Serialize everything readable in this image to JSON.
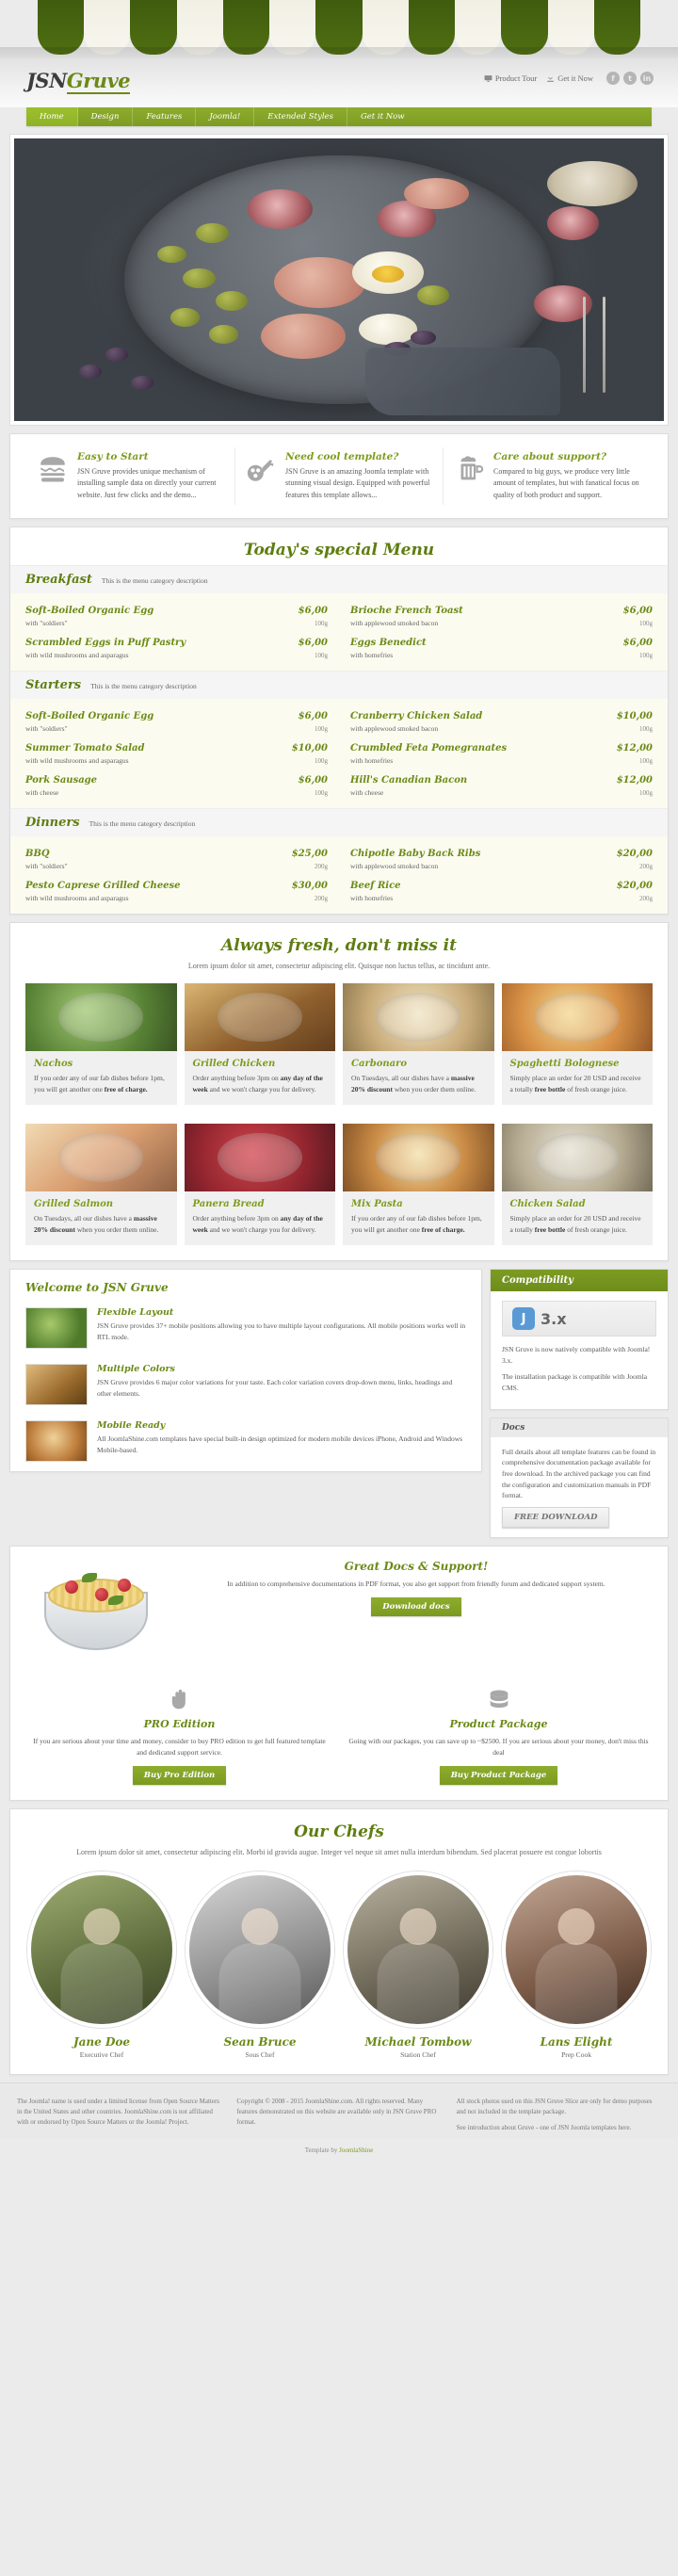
{
  "brand": {
    "logo_jsn": "JSN",
    "logo_gruve": "Gruve"
  },
  "topbar": {
    "product_tour": "Product Tour",
    "get_it_now": "Get it Now",
    "social": [
      "f",
      "t",
      "in"
    ]
  },
  "nav": [
    {
      "label": "Home",
      "active": true
    },
    {
      "label": "Design",
      "active": false
    },
    {
      "label": "Features",
      "active": false
    },
    {
      "label": "Joomla!",
      "active": false
    },
    {
      "label": "Extended Styles",
      "active": false
    },
    {
      "label": "Get it Now",
      "active": false
    }
  ],
  "features": [
    {
      "icon": "burger-icon",
      "title": "Easy to Start",
      "text": "JSN Gruve provides unique mechanism of installing sample data on directly your current website. Just few clicks and the demo..."
    },
    {
      "icon": "chicken-leg-icon",
      "title": "Need cool template?",
      "text": "JSN Gruve is an amazing Joomla template with stunning visual design. Equipped with powerful features this template allows..."
    },
    {
      "icon": "beer-mug-icon",
      "title": "Care about support?",
      "text": "Compared to big guys, we produce very little amount of templates, but with fanatical focus on quality of both product and support."
    }
  ],
  "menu": {
    "title": "Today's special Menu",
    "categories": [
      {
        "name": "Breakfast",
        "description": "This is the menu category description",
        "items": [
          {
            "name": "Soft-Boiled Organic Egg",
            "price": "$6,00",
            "desc": "with \"soldiers\"",
            "weight": "100g"
          },
          {
            "name": "Brioche French Toast",
            "price": "$6,00",
            "desc": "with applewood smoked bacon",
            "weight": "100g"
          },
          {
            "name": "Scrambled Eggs in Puff Pastry",
            "price": "$6,00",
            "desc": "with wild mushrooms and asparagus",
            "weight": "100g"
          },
          {
            "name": "Eggs Benedict",
            "price": "$6,00",
            "desc": "with homefries",
            "weight": "100g"
          }
        ]
      },
      {
        "name": "Starters",
        "description": "This is the menu category description",
        "items": [
          {
            "name": "Soft-Boiled Organic Egg",
            "price": "$6,00",
            "desc": "with \"soldiers\"",
            "weight": "100g"
          },
          {
            "name": "Cranberry Chicken Salad",
            "price": "$10,00",
            "desc": "with applewood smoked bacon",
            "weight": "100g"
          },
          {
            "name": "Summer Tomato Salad",
            "price": "$10,00",
            "desc": "with wild mushrooms and asparagus",
            "weight": "100g"
          },
          {
            "name": "Crumbled Feta Pomegranates",
            "price": "$12,00",
            "desc": "with homefries",
            "weight": "100g"
          },
          {
            "name": "Pork Sausage",
            "price": "$6,00",
            "desc": "with cheese",
            "weight": "100g"
          },
          {
            "name": "Hill's Canadian Bacon",
            "price": "$12,00",
            "desc": "with cheese",
            "weight": "100g"
          }
        ]
      },
      {
        "name": "Dinners",
        "description": "This is the menu category description",
        "items": [
          {
            "name": "BBQ",
            "price": "$25,00",
            "desc": "with \"soldiers\"",
            "weight": "200g"
          },
          {
            "name": "Chipotle Baby Back Ribs",
            "price": "$20,00",
            "desc": "with applewood smoked bacon",
            "weight": "200g"
          },
          {
            "name": "Pesto Caprese Grilled Cheese",
            "price": "$30,00",
            "desc": "with wild mushrooms and asparagus",
            "weight": "200g"
          },
          {
            "name": "Beef Rice",
            "price": "$20,00",
            "desc": "with homefries",
            "weight": "200g"
          }
        ]
      }
    ]
  },
  "fresh": {
    "title": "Always fresh, don't miss it",
    "subtitle": "Lorem ipsum dolor sit amet, consectetur adipiscing elit. Quisque non luctus tellus, ac tincidunt ante.",
    "cards": [
      {
        "art": "ci-salad",
        "title": "Nachos",
        "text_1": "If you order any of our fab dishes before 1pm, you will get another one ",
        "bold": "free of charge.",
        "text_2": ""
      },
      {
        "art": "ci-chicken",
        "title": "Grilled Chicken",
        "text_1": "Order anything before 3pm on ",
        "bold": "any day of the week",
        "text_2": " and we won't charge you for delivery."
      },
      {
        "art": "ci-carbonara",
        "title": "Carbonaro",
        "text_1": "On Tuesdays, all our dishes have a ",
        "bold": "massive 20% discount",
        "text_2": " when you order them online."
      },
      {
        "art": "ci-bolognese",
        "title": "Spaghetti Bolognese",
        "text_1": "Simply place an order for 20 USD and receive a totally ",
        "bold": "free bottle",
        "text_2": " of fresh orange juice."
      },
      {
        "art": "ci-salmon",
        "title": "Grilled Salmon",
        "text_1": "On Tuesdays, all our dishes have a ",
        "bold": "massive 20% discount",
        "text_2": " when you order them online."
      },
      {
        "art": "ci-panera",
        "title": "Panera Bread",
        "text_1": "Order anything before 3pm on ",
        "bold": "any day of the week",
        "text_2": " and we won't charge you for delivery."
      },
      {
        "art": "ci-pasta",
        "title": "Mix Pasta",
        "text_1": "If you order any of our fab dishes before 1pm, you will get another one ",
        "bold": "free of charge.",
        "text_2": ""
      },
      {
        "art": "ci-chsalad",
        "title": "Chicken Salad",
        "text_1": "Simply place an order for 20 USD and receive a totally ",
        "bold": "free bottle",
        "text_2": " of fresh orange juice."
      }
    ]
  },
  "welcome": {
    "title": "Welcome to JSN Gruve",
    "rows": [
      {
        "art": "wi-sprouts",
        "title": "Flexible Layout",
        "text": "JSN Gruve provides 37+ mobile positions allowing you to have multiple layout configurations. All mobile positions works well in RTL mode."
      },
      {
        "art": "wi-bread",
        "title": "Multiple Colors",
        "text": "JSN Gruve provides 6 major color variations for your taste. Each color variation covers drop-down menu, links, headings and other elements."
      },
      {
        "art": "wi-bowl",
        "title": "Mobile Ready",
        "text": "All JoomlaShine.com templates have special built-in design optimized for modern mobile devices iPhone, Android and Windows Mobile-based."
      }
    ]
  },
  "sidebar": {
    "compat_title": "Compatibility",
    "joomla_label": "Joomla!",
    "joomla_version": "3.x",
    "compat_text_1": "JSN Gruve is now natively compatible with Joomla! 3.x.",
    "compat_text_2": "The installation package is compatible with Joomla CMS.",
    "docs_title": "Docs",
    "docs_text": "Full details about all template features can be found in comprehensive documentation package available for free download. In the archived package you can find the configuration and customization manuals in PDF format.",
    "docs_button": "FREE DOWNLOAD"
  },
  "support": {
    "title": "Great Docs & Support!",
    "text": "In addition to comprehensive documentations in PDF format, you also get support from friendly forum and dedicated support system.",
    "button": "Download docs",
    "promos": [
      {
        "icon": "hand-icon",
        "title": "PRO Edition",
        "text": "If you are serious about your time and money, consider to buy PRO edition to get full featured template and dedicated support service.",
        "button": "Buy Pro Edition"
      },
      {
        "icon": "money-icon",
        "title": "Product Package",
        "text": "Going with our packages, you can save up to ~$2500. If you are serious about your money, don't miss this deal",
        "button": "Buy Product Package"
      }
    ]
  },
  "chefs": {
    "title": "Our Chefs",
    "subtitle": "Lorem ipsum dolor sit amet, consectetur adipiscing elit. Morbi id gravida augue. Integer vel neque sit amet nulla interdum bibendum. Sed placerat posuere est congue lobortis",
    "people": [
      {
        "art": "cp-1",
        "name": "Jane Doe",
        "role": "Executive Chef"
      },
      {
        "art": "cp-2",
        "name": "Sean Bruce",
        "role": "Sous Chef"
      },
      {
        "art": "cp-3",
        "name": "Michael Tombow",
        "role": "Station Chef"
      },
      {
        "art": "cp-4",
        "name": "Lans Elight",
        "role": "Prep Cook"
      }
    ]
  },
  "footer": {
    "col1": "The Joomla! name is used under a limited license from Open Source Matters in the United States and other countries. JoomlaShine.com is not affiliated with or endorsed by Open Source Matters or the Joomla! Project.",
    "col2": "Copyright © 2008 - 2015 JoomlaShine.com. All rights reserved. Many features demonstrated on this website are available only in JSN Gruve PRO format.",
    "col3": "All stock photos used on this JSN Gruve Slice are only for demo purposes and not included in the template package.",
    "col3b": "See introduction about Gruve - one of JSN Joomla templates here.",
    "bottom_prefix": "Template by ",
    "bottom_link": "JoomlaShine"
  }
}
